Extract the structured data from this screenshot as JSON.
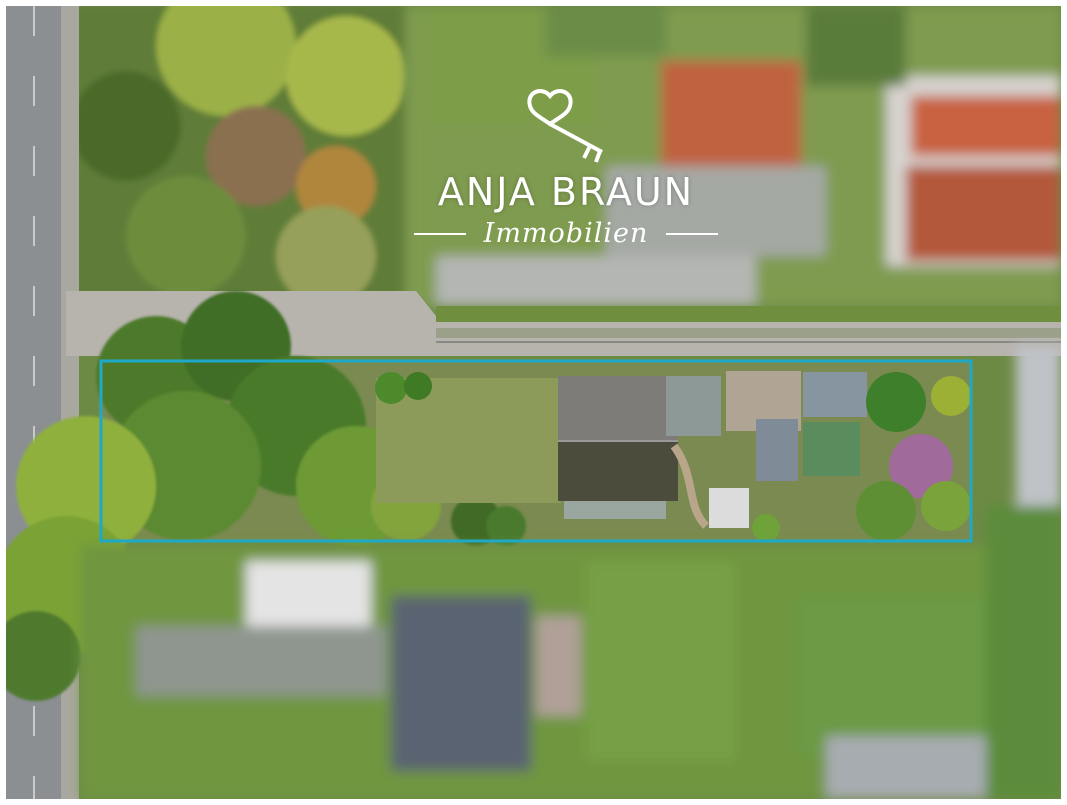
{
  "image": {
    "subject": "Aerial photo of a plot of land outlined in blue",
    "plot_outline_color": "#1ea9c9"
  },
  "watermark": {
    "brand": "ANJA BRAUN",
    "tagline": "Immobilien",
    "icon": "heart-key-icon"
  }
}
